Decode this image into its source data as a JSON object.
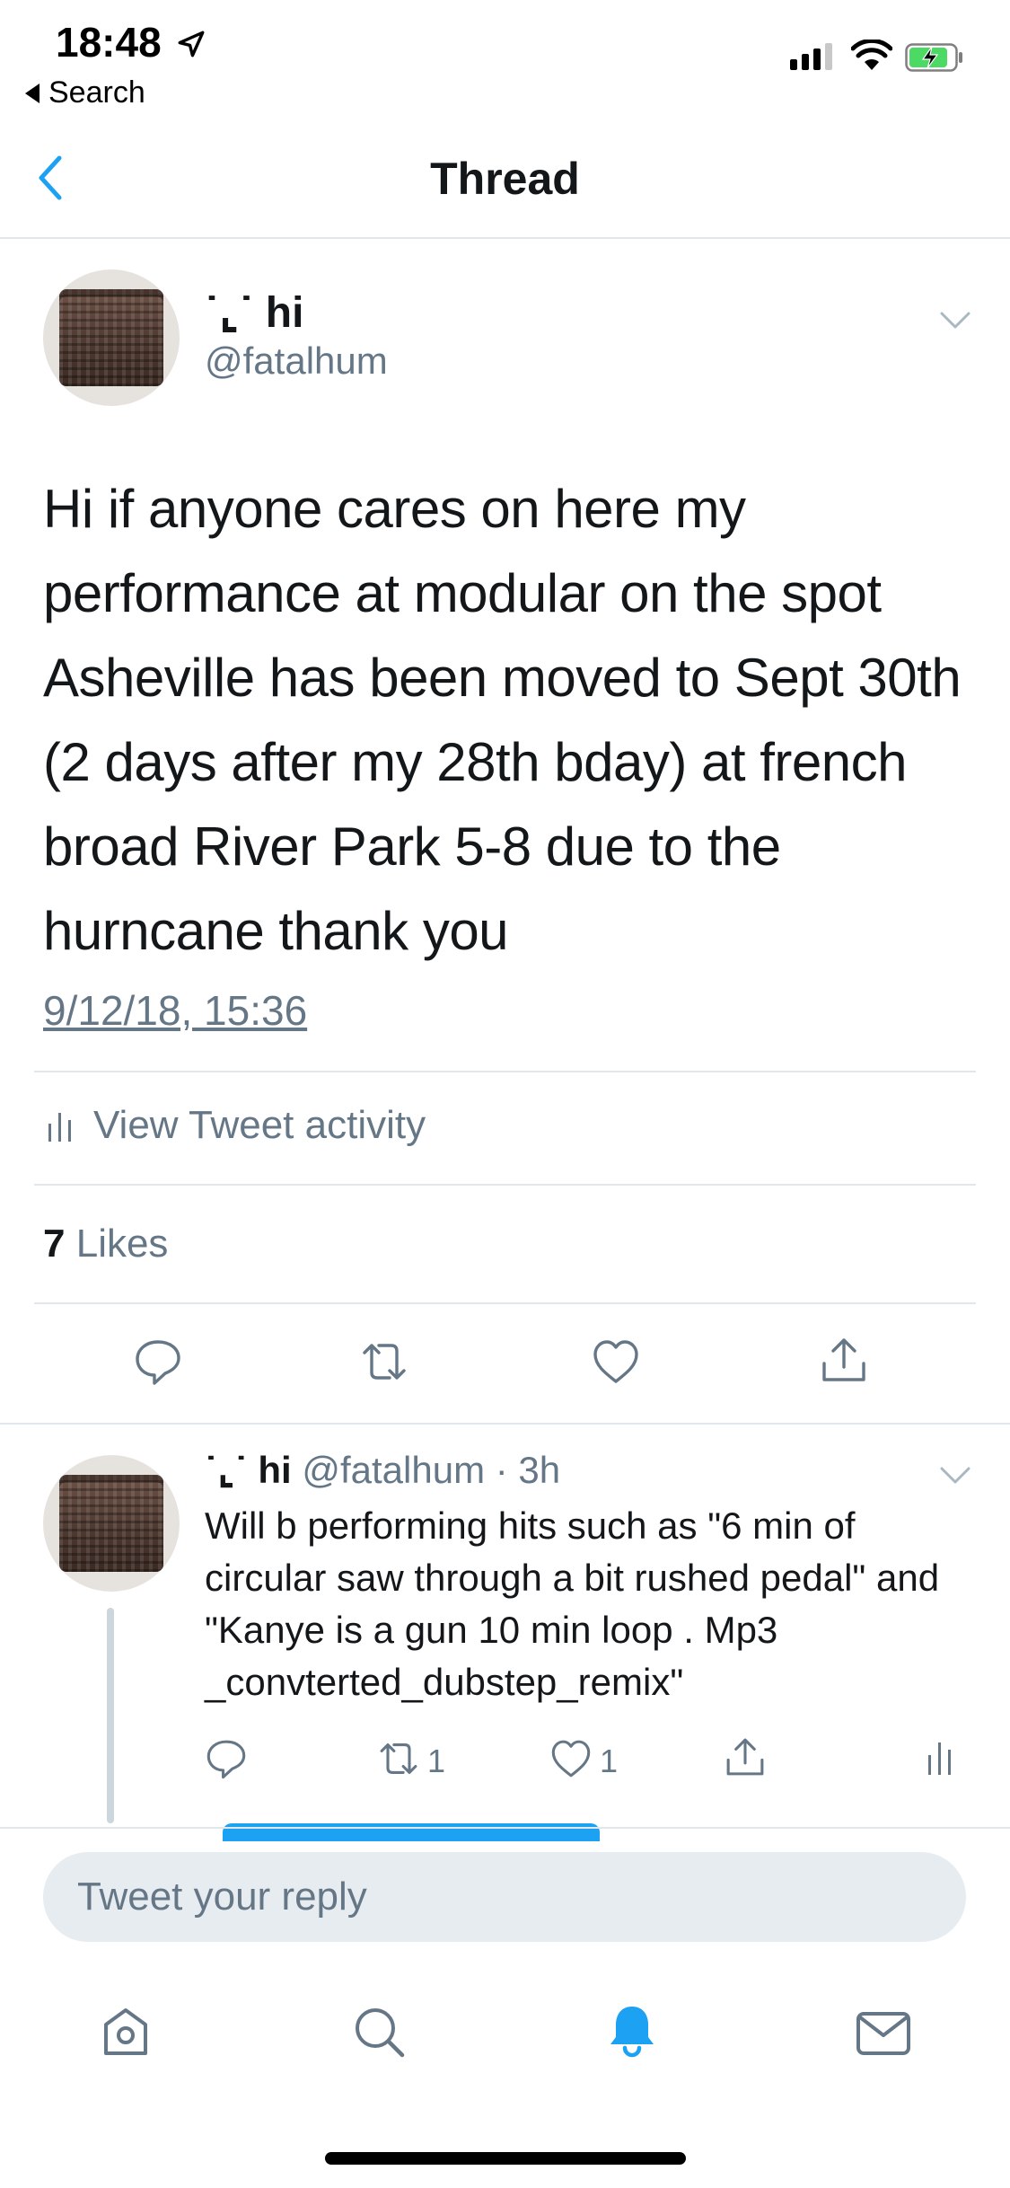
{
  "status_bar": {
    "time": "18:48",
    "back_label": "Search"
  },
  "header": {
    "title": "Thread"
  },
  "tweet": {
    "display_name": "˙⌞˙ hi",
    "handle": "@fatalhum",
    "text": "Hi if anyone cares on here my performance at modular on the spot Asheville has been moved to Sept 30th (2 days after my 28th bday) at french broad River Park 5-8 due to the hurncane thank you",
    "timestamp": "9/12/18, 15:36",
    "activity_label": "View Tweet activity",
    "likes_count": "7",
    "likes_label": "Likes"
  },
  "reply": {
    "display_name": "˙⌞˙ hi",
    "handle_time": "@fatalhum · 3h",
    "text": "Will b performing hits such as \"6 min of circular saw through a bit rushed pedal\" and \"Kanye is a gun 10 min loop . Mp3 _convterted_dubstep_remix\"",
    "retweets": "1",
    "likes": "1"
  },
  "composer": {
    "placeholder": "Tweet your reply"
  },
  "colors": {
    "accent": "#1da1f2",
    "secondary_text": "#657786",
    "divider": "#e1e8ed"
  },
  "icons": [
    "location-arrow-icon",
    "signal-icon",
    "wifi-icon",
    "battery-charging-icon",
    "back-chevron-icon",
    "chevron-down-icon",
    "activity-bars-icon",
    "reply-icon",
    "retweet-icon",
    "like-icon",
    "share-icon",
    "home-icon",
    "search-icon",
    "notifications-icon",
    "messages-icon"
  ]
}
